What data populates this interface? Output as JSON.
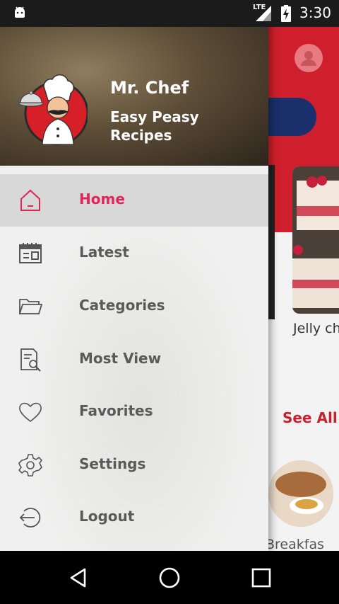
{
  "status_bar": {
    "network": "LTE",
    "time": "3:30",
    "icons": [
      "android-icon",
      "lte-signal-icon",
      "battery-charging-icon"
    ]
  },
  "drawer": {
    "app_name": "Mr. Chef",
    "tagline": "Easy Peasy Recipes",
    "items": [
      {
        "label": "Home",
        "icon": "home-icon",
        "active": true
      },
      {
        "label": "Latest",
        "icon": "calendar-icon",
        "active": false
      },
      {
        "label": "Categories",
        "icon": "folder-icon",
        "active": false
      },
      {
        "label": "Most View",
        "icon": "document-search-icon",
        "active": false
      },
      {
        "label": "Favorites",
        "icon": "heart-icon",
        "active": false
      },
      {
        "label": "Settings",
        "icon": "gear-icon",
        "active": false
      },
      {
        "label": "Logout",
        "icon": "logout-icon",
        "active": false
      }
    ]
  },
  "background_app": {
    "recipe_title": "Jelly ch",
    "see_all": "See All",
    "category_title": "Breakfas"
  },
  "nav_bar": {
    "buttons": [
      "back-icon",
      "home-circle-icon",
      "recents-icon"
    ]
  },
  "colors": {
    "accent_pink": "#e0245e",
    "brand_red": "#cf1f2c",
    "see_all_red": "#c8202e",
    "navy": "#1a2f6b"
  }
}
